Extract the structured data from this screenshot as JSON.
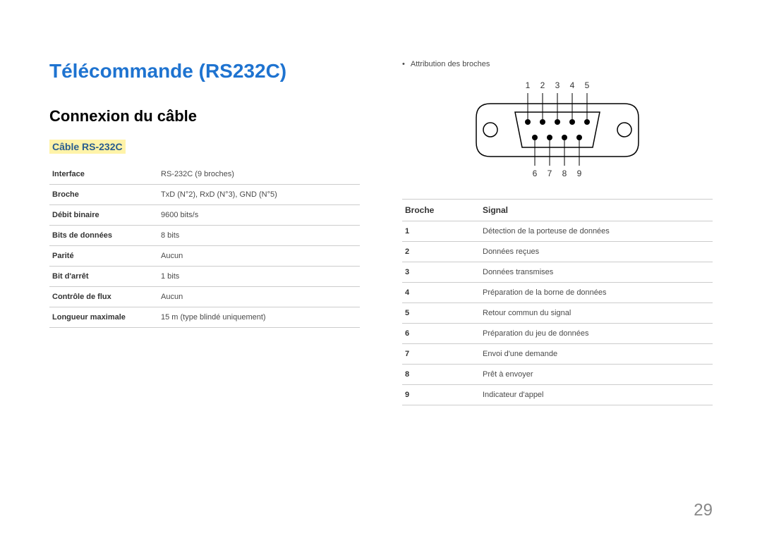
{
  "main_title": "Télécommande (RS232C)",
  "section_title": "Connexion du câble",
  "sub_title": "Câble RS-232C",
  "spec_rows": [
    {
      "label": "Interface",
      "value": "RS-232C (9 broches)"
    },
    {
      "label": "Broche",
      "value": "TxD (N°2), RxD (N°3), GND (N°5)"
    },
    {
      "label": "Débit binaire",
      "value": "9600 bits/s"
    },
    {
      "label": "Bits de données",
      "value": "8 bits"
    },
    {
      "label": "Parité",
      "value": "Aucun"
    },
    {
      "label": "Bit d'arrêt",
      "value": "1 bits"
    },
    {
      "label": "Contrôle de flux",
      "value": "Aucun"
    },
    {
      "label": "Longueur maximale",
      "value": "15 m (type blindé uniquement)"
    }
  ],
  "bullet_text": "Attribution des broches",
  "pin_header": {
    "col1": "Broche",
    "col2": "Signal"
  },
  "pin_rows": [
    {
      "num": "1",
      "signal": "Détection de la porteuse de données"
    },
    {
      "num": "2",
      "signal": "Données reçues"
    },
    {
      "num": "3",
      "signal": "Données transmises"
    },
    {
      "num": "4",
      "signal": "Préparation de la borne de données"
    },
    {
      "num": "5",
      "signal": "Retour commun du signal"
    },
    {
      "num": "6",
      "signal": "Préparation du jeu de données"
    },
    {
      "num": "7",
      "signal": "Envoi d'une demande"
    },
    {
      "num": "8",
      "signal": "Prêt à envoyer"
    },
    {
      "num": "9",
      "signal": "Indicateur d'appel"
    }
  ],
  "diagram_labels_top": [
    "1",
    "2",
    "3",
    "4",
    "5"
  ],
  "diagram_labels_bottom": [
    "6",
    "7",
    "8",
    "9"
  ],
  "page_number": "29"
}
